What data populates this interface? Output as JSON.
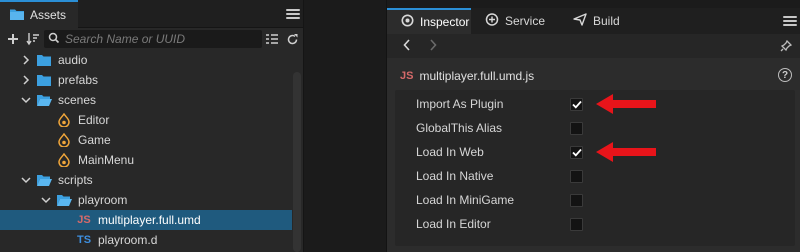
{
  "assets": {
    "tab_label": "Assets",
    "search": {
      "placeholder": "Search Name or UUID",
      "value": ""
    },
    "tree": [
      {
        "label": "audio",
        "type": "folder",
        "expanded": false,
        "depth": 0
      },
      {
        "label": "prefabs",
        "type": "folder",
        "expanded": false,
        "depth": 0
      },
      {
        "label": "scenes",
        "type": "folder",
        "expanded": true,
        "depth": 0
      },
      {
        "label": "Editor",
        "type": "scene",
        "depth": 1
      },
      {
        "label": "Game",
        "type": "scene",
        "depth": 1
      },
      {
        "label": "MainMenu",
        "type": "scene",
        "depth": 1
      },
      {
        "label": "scripts",
        "type": "folder",
        "expanded": true,
        "depth": 0
      },
      {
        "label": "playroom",
        "type": "folder",
        "expanded": true,
        "depth": 1
      },
      {
        "label": "multiplayer.full.umd",
        "type": "js",
        "depth": 2,
        "selected": true
      },
      {
        "label": "playroom.d",
        "type": "ts",
        "depth": 2
      }
    ]
  },
  "inspector": {
    "tabs": [
      {
        "label": "Inspector",
        "icon": "gear-icon",
        "active": true
      },
      {
        "label": "Service",
        "icon": "cloud-icon",
        "active": false
      },
      {
        "label": "Build",
        "icon": "send-icon",
        "active": false
      }
    ],
    "file_type": "JS",
    "file_name": "multiplayer.full.umd.js",
    "help": "?",
    "properties": [
      {
        "label": "Import As Plugin",
        "checked": true,
        "annotated": true
      },
      {
        "label": "GlobalThis Alias",
        "checked": false,
        "annotated": false
      },
      {
        "label": "Load In Web",
        "checked": true,
        "annotated": true
      },
      {
        "label": "Load In Native",
        "checked": false,
        "annotated": false
      },
      {
        "label": "Load In MiniGame",
        "checked": false,
        "annotated": false
      },
      {
        "label": "Load In Editor",
        "checked": false,
        "annotated": false
      }
    ]
  },
  "colors": {
    "accent": "#2b8fd6",
    "selection": "#1f5a7e",
    "folder": "#3ca0e0",
    "scene": "#f0a63a",
    "annotation": "#e8141a"
  }
}
